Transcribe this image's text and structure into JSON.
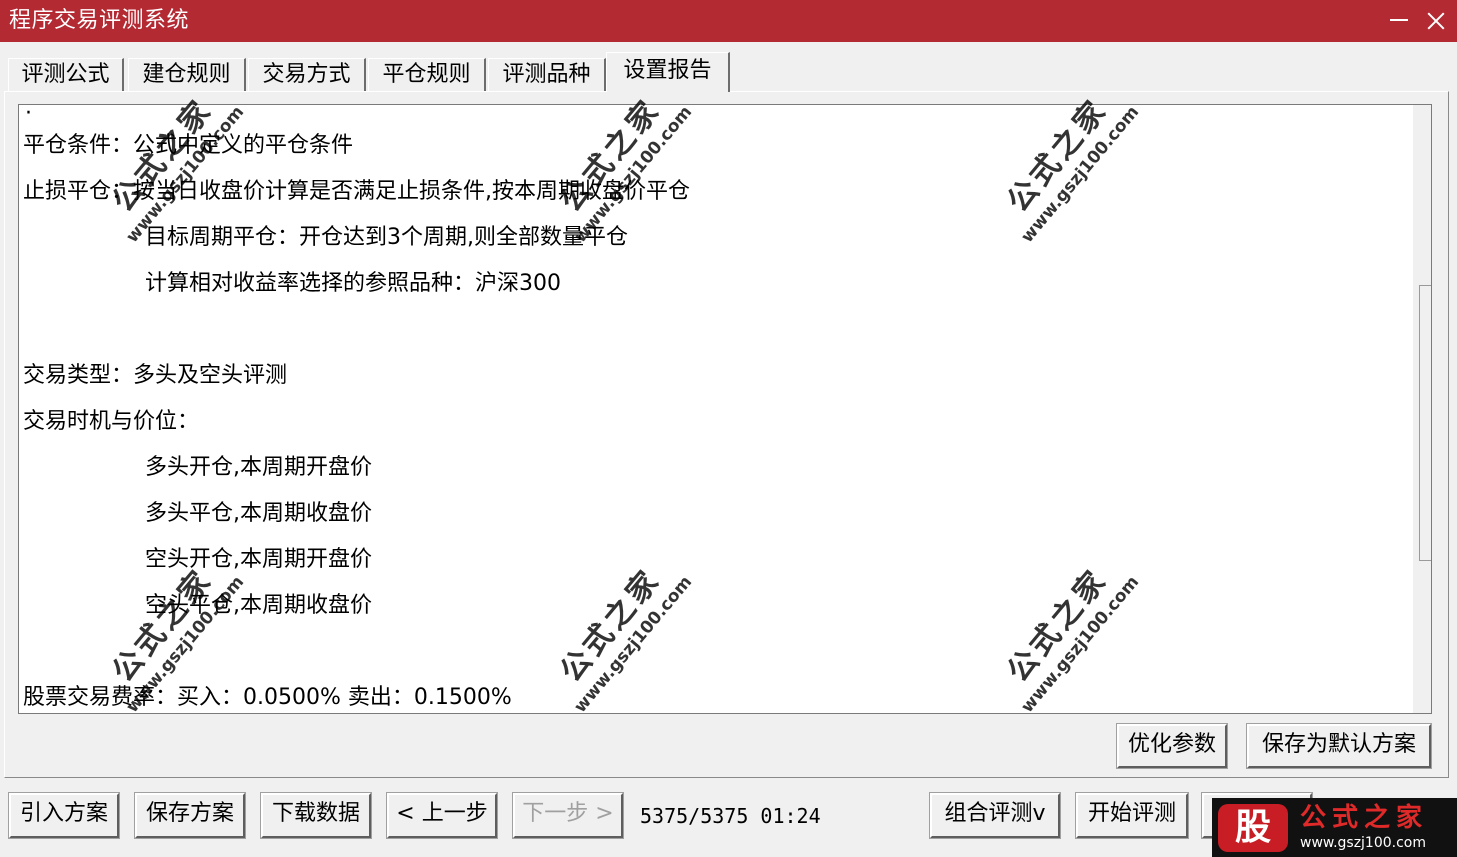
{
  "window": {
    "title": "程序交易评测系统"
  },
  "tabs": [
    {
      "label": "评测公式"
    },
    {
      "label": "建仓规则"
    },
    {
      "label": "交易方式"
    },
    {
      "label": "平仓规则"
    },
    {
      "label": "评测品种"
    },
    {
      "label": "设置报告"
    }
  ],
  "active_tab": "设置报告",
  "report": {
    "lines": [
      "平仓条件：公式中定义的平仓条件",
      "止损平仓：按当日收盘价计算是否满足止损条件,按本周期收盘价平仓",
      "目标周期平仓：开仓达到3个周期,则全部数量平仓",
      "计算相对收益率选择的参照品种：沪深300",
      "交易类型：多头及空头评测",
      "交易时机与价位：",
      "多头开仓,本周期开盘价",
      "多头平仓,本周期收盘价",
      "空头开仓,本周期开盘价",
      "空头平仓,本周期收盘价",
      "股票交易费率：买入：0.0500%  卖出：0.1500%"
    ]
  },
  "panel_buttons": {
    "optimize": "优化参数",
    "save_default": "保存为默认方案"
  },
  "bottom_bar": {
    "import": "引入方案",
    "save": "保存方案",
    "download": "下载数据",
    "prev": "< 上一步",
    "next": "下一步 >",
    "status": "5375/5375 01:24",
    "combo": "组合评测v",
    "start": "开始评测"
  },
  "watermark": {
    "title": "公式之家",
    "url": "www.gszj100.com"
  },
  "logo": {
    "mark": "股",
    "title": "公式之家",
    "url": "www.gszj100.com"
  }
}
